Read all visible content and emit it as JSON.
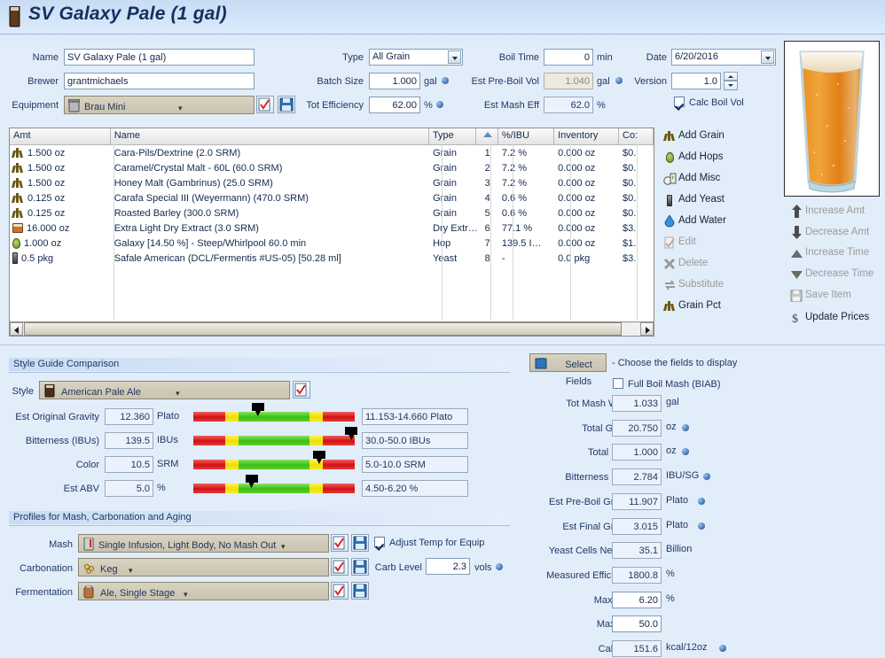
{
  "window": {
    "title": "SV Galaxy Pale (1 gal)",
    "icon": "beer-glass-icon"
  },
  "recipe": {
    "name_label": "Name",
    "name_value": "SV Galaxy Pale (1 gal)",
    "brewer_label": "Brewer",
    "brewer_value": "grantmichaels",
    "equipment_label": "Equipment",
    "equipment_value": "Brau Mini",
    "type_label": "Type",
    "type_value": "All Grain",
    "batch_size_label": "Batch Size",
    "batch_size_value": "1.000",
    "batch_size_unit": "gal",
    "tot_efficiency_label": "Tot Efficiency",
    "tot_efficiency_value": "62.00",
    "tot_efficiency_unit": "%",
    "boil_time_label": "Boil Time",
    "boil_time_value": "0",
    "boil_time_unit": "min",
    "est_preboil_vol_label": "Est Pre-Boil Vol",
    "est_preboil_vol_value": "1.040",
    "est_preboil_vol_unit": "gal",
    "est_mash_eff_label": "Est Mash Eff",
    "est_mash_eff_value": "62.0",
    "est_mash_eff_unit": "%",
    "date_label": "Date",
    "date_value": "6/20/2016",
    "version_label": "Version",
    "version_value": "1.0",
    "calc_boil_vol_label": "Calc Boil Vol",
    "calc_boil_vol_checked": true
  },
  "grid": {
    "columns": [
      "Amt",
      "Name",
      "Type",
      "",
      "%/IBU",
      "Inventory",
      "Co:"
    ],
    "rows": [
      {
        "icon": "grain-icon",
        "amt": "1.500 oz",
        "name": "Cara-Pils/Dextrine (2.0 SRM)",
        "type": "Grain",
        "num": "1",
        "pct": "7.2 %",
        "inventory": "0.000 oz",
        "cost": "$0."
      },
      {
        "icon": "grain-icon",
        "amt": "1.500 oz",
        "name": "Caramel/Crystal Malt - 60L (60.0 SRM)",
        "type": "Grain",
        "num": "2",
        "pct": "7.2 %",
        "inventory": "0.000 oz",
        "cost": "$0."
      },
      {
        "icon": "grain-icon",
        "amt": "1.500 oz",
        "name": "Honey Malt (Gambrinus) (25.0 SRM)",
        "type": "Grain",
        "num": "3",
        "pct": "7.2 %",
        "inventory": "0.000 oz",
        "cost": "$0."
      },
      {
        "icon": "grain-icon",
        "amt": "0.125 oz",
        "name": "Carafa Special III (Weyermann) (470.0 SRM)",
        "type": "Grain",
        "num": "4",
        "pct": "0.6 %",
        "inventory": "0.000 oz",
        "cost": "$0."
      },
      {
        "icon": "grain-icon",
        "amt": "0.125 oz",
        "name": "Roasted Barley (300.0 SRM)",
        "type": "Grain",
        "num": "5",
        "pct": "0.6 %",
        "inventory": "0.000 oz",
        "cost": "$0."
      },
      {
        "icon": "extract-icon",
        "amt": "16.000 oz",
        "name": "Extra Light Dry Extract (3.0 SRM)",
        "type": "Dry Extr…",
        "num": "6",
        "pct": "77.1 %",
        "inventory": "0.000 oz",
        "cost": "$3."
      },
      {
        "icon": "hop-icon",
        "amt": "1.000 oz",
        "name": "Galaxy [14.50 %] - Steep/Whirlpool  60.0 min",
        "type": "Hop",
        "num": "7",
        "pct": "139.5 I…",
        "inventory": "0.000 oz",
        "cost": "$1."
      },
      {
        "icon": "yeast-icon",
        "amt": "0.5 pkg",
        "name": "Safale American  (DCL/Fermentis #US-05) [50.28 ml]",
        "type": "Yeast",
        "num": "8",
        "pct": "-",
        "inventory": "0.0 pkg",
        "cost": "$3."
      }
    ]
  },
  "actions_left": [
    {
      "label": "Add Grain",
      "icon": "grain-icon",
      "enabled": true
    },
    {
      "label": "Add Hops",
      "icon": "hop-icon",
      "enabled": true
    },
    {
      "label": "Add Misc",
      "icon": "misc-icon",
      "enabled": true
    },
    {
      "label": "Add Yeast",
      "icon": "yeast-icon",
      "enabled": true
    },
    {
      "label": "Add Water",
      "icon": "water-drop-icon",
      "enabled": true
    },
    {
      "label": "Edit",
      "icon": "edit-icon",
      "enabled": false
    },
    {
      "label": "Delete",
      "icon": "delete-x-icon",
      "enabled": false
    },
    {
      "label": "Substitute",
      "icon": "substitute-icon",
      "enabled": false
    },
    {
      "label": "Grain Pct",
      "icon": "grain-icon",
      "enabled": true
    }
  ],
  "actions_right": [
    {
      "label": "Increase Amt",
      "icon": "arrow-up-icon",
      "enabled": false
    },
    {
      "label": "Decrease Amt",
      "icon": "arrow-down-icon",
      "enabled": false
    },
    {
      "label": "Increase Time",
      "icon": "triangle-up-icon",
      "enabled": false
    },
    {
      "label": "Decrease Time",
      "icon": "triangle-down-icon",
      "enabled": false
    },
    {
      "label": "Save Item",
      "icon": "floppy-disk-icon",
      "enabled": false
    },
    {
      "label": "Update Prices",
      "icon": "dollar-sign-icon",
      "enabled": true
    }
  ],
  "style_panel": {
    "header": "Style Guide Comparison",
    "style_label": "Style",
    "style_value": "American Pale Ale",
    "rows": [
      {
        "label": "Est Original Gravity",
        "value": "12.360",
        "unit": "Plato",
        "range": "11.153-14.660 Plato",
        "marker_pct": 40
      },
      {
        "label": "Bitterness (IBUs)",
        "value": "139.5",
        "unit": "IBUs",
        "range": "30.0-50.0 IBUs",
        "marker_pct": 98
      },
      {
        "label": "Color",
        "value": "10.5",
        "unit": "SRM",
        "range": "5.0-10.0 SRM",
        "marker_pct": 78
      },
      {
        "label": "Est ABV",
        "value": "5.0",
        "unit": "%",
        "range": "4.50-6.20 %",
        "marker_pct": 36
      }
    ]
  },
  "profiles_panel": {
    "header": "Profiles for Mash, Carbonation and Aging",
    "mash_label": "Mash",
    "mash_value": "Single Infusion, Light Body, No Mash Out",
    "carbonation_label": "Carbonation",
    "carbonation_value": "Keg",
    "fermentation_label": "Fermentation",
    "fermentation_value": "Ale, Single Stage",
    "adjust_temp_label": "Adjust Temp for Equip",
    "adjust_temp_checked": true,
    "carb_level_label": "Carb Level",
    "carb_level_value": "2.3",
    "carb_level_unit": "vols"
  },
  "stats_panel": {
    "select_fields_label": "Select Fields",
    "select_fields_hint": "- Choose the fields to display",
    "biab_label": "Full Boil Mash (BIAB)",
    "biab_checked": false,
    "rows": [
      {
        "label": "Tot Mash Water",
        "value": "1.033",
        "unit": "gal",
        "dot": false,
        "editable": false
      },
      {
        "label": "Total Grains",
        "value": "20.750",
        "unit": "oz",
        "dot": true,
        "editable": false
      },
      {
        "label": "Total Hops",
        "value": "1.000",
        "unit": "oz",
        "dot": true,
        "editable": false
      },
      {
        "label": "Bitterness Ratio",
        "value": "2.784",
        "unit": "IBU/SG",
        "dot": true,
        "editable": false
      },
      {
        "label": "Est Pre-Boil Gravity",
        "value": "11.907",
        "unit": "Plato",
        "dot": true,
        "editable": false
      },
      {
        "label": "Est Final Gravity",
        "value": "3.015",
        "unit": "Plato",
        "dot": true,
        "editable": false
      },
      {
        "label": "Yeast Cells Needed",
        "value": "35.1",
        "unit": "Billion",
        "dot": false,
        "editable": false
      },
      {
        "label": "Measured Efficiency",
        "value": "1800.8",
        "unit": "%",
        "dot": false,
        "editable": false
      },
      {
        "label": "Max ABV",
        "value": "6.20",
        "unit": "%",
        "dot": false,
        "editable": true
      },
      {
        "label": "Max IBU",
        "value": "50.0",
        "unit": "",
        "dot": false,
        "editable": true
      },
      {
        "label": "Calories",
        "value": "151.6",
        "unit": "kcal/12oz",
        "dot": true,
        "editable": false
      }
    ]
  },
  "colors": {
    "background": "#e2edfa",
    "accent": "#3a6fae",
    "text": "#1f3864"
  }
}
